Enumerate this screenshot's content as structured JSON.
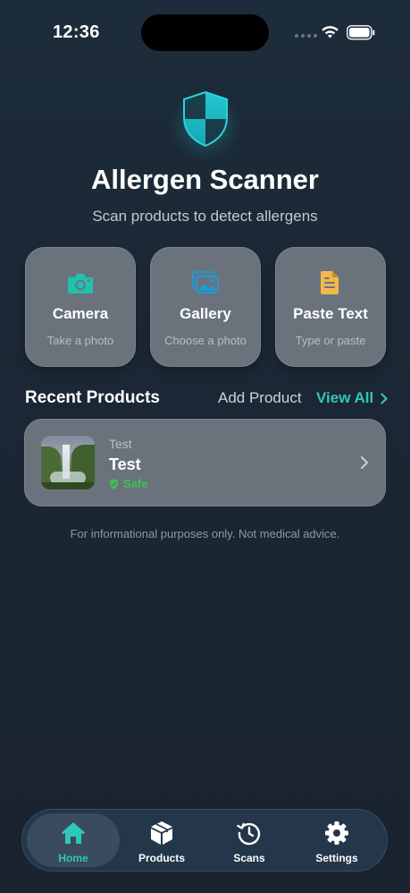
{
  "status_bar": {
    "time": "12:36"
  },
  "header": {
    "title": "Allergen Scanner",
    "subtitle": "Scan products to detect allergens",
    "logo_icon": "shield-icon"
  },
  "actions": [
    {
      "label": "Camera",
      "sub": "Take a photo",
      "icon": "camera-icon",
      "color": "#20c1ad"
    },
    {
      "label": "Gallery",
      "sub": "Choose a photo",
      "icon": "photos-icon",
      "color": "#1a9ad8"
    },
    {
      "label": "Paste Text",
      "sub": "Type or paste",
      "icon": "document-icon",
      "color": "#f2b84b"
    }
  ],
  "recent": {
    "title": "Recent Products",
    "add_label": "Add Product",
    "view_all_label": "View All",
    "items": [
      {
        "brand": "Test",
        "name": "Test",
        "status": "Safe",
        "status_color": "#3fbf5a"
      }
    ]
  },
  "disclaimer": "For informational purposes only. Not medical advice.",
  "tabs": [
    {
      "label": "Home",
      "icon": "home-icon",
      "active": true
    },
    {
      "label": "Products",
      "icon": "box-icon",
      "active": false
    },
    {
      "label": "Scans",
      "icon": "history-icon",
      "active": false
    },
    {
      "label": "Settings",
      "icon": "gear-icon",
      "active": false
    }
  ],
  "colors": {
    "accent": "#2ec8b6",
    "background": "#1b2734",
    "card": "#6a737c"
  }
}
